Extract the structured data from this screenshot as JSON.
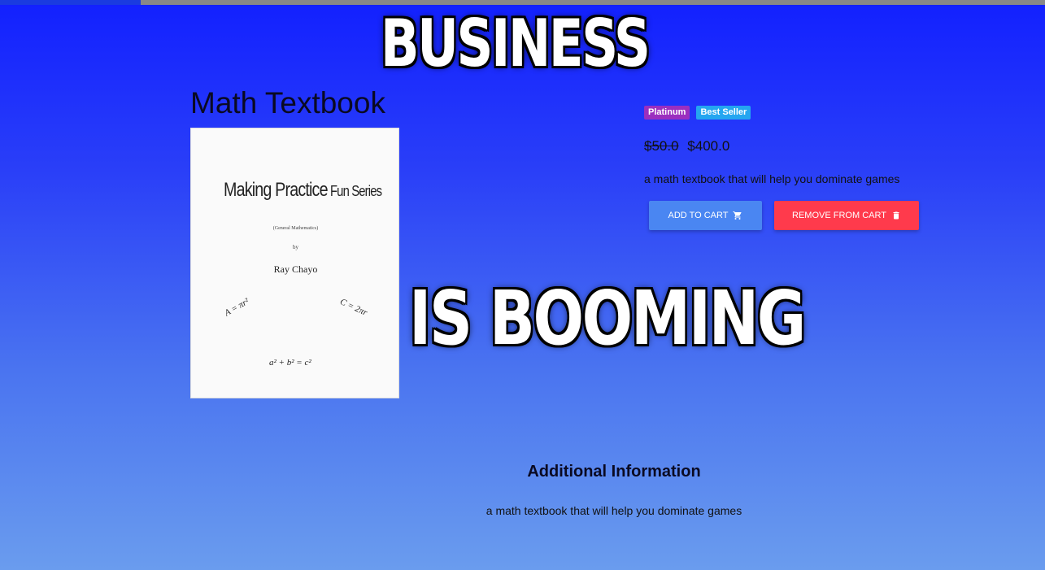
{
  "page_progress": {
    "fraction": 0.135
  },
  "meme": {
    "top_text": "BUSINESS",
    "bottom_text": "IS BOOMING"
  },
  "product": {
    "title": "Math Textbook",
    "badges": [
      "Platinum",
      "Best Seller"
    ],
    "old_price": "$50.0",
    "price": "$400.0",
    "description": "a math textbook that will help you dominate games",
    "cover": {
      "series_main": "Making Practice",
      "series_rest": " Fun Series",
      "subtitle": "(General Mathematics)",
      "by": "by",
      "author": "Ray Chayo",
      "formula_1": "A = πr²",
      "formula_2": "C = 2πr",
      "formula_3": "a² + b² = c²"
    }
  },
  "actions": {
    "add_label": "ADD TO CART",
    "remove_label": "REMOVE FROM CART",
    "add_icon": "cart-icon",
    "remove_icon": "trash-icon"
  },
  "additional": {
    "title": "Additional Information",
    "text": "a math textbook that will help you dominate games"
  },
  "colors": {
    "background_top": "#1220ff",
    "background_bottom": "#6a9cee",
    "badge_platinum": "#9b2fbf",
    "badge_best_seller": "#24a6f0",
    "add_button": "#4a86f2",
    "remove_button": "#ff3a4c"
  }
}
